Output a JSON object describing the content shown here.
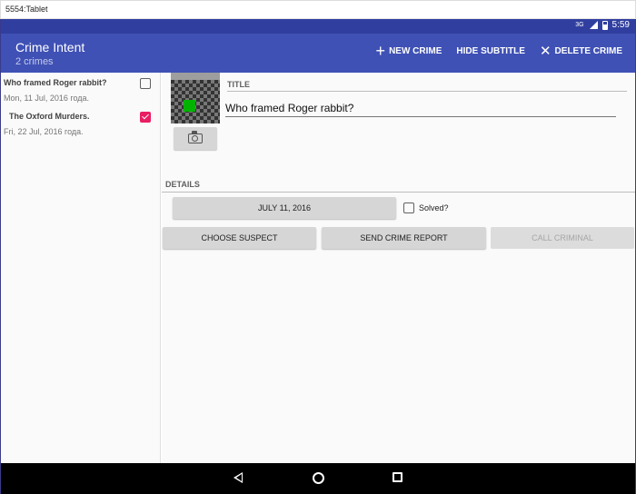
{
  "window": {
    "title": "5554:Tablet"
  },
  "status_bar": {
    "network": "3G",
    "time": "5:59"
  },
  "app_bar": {
    "title": "Crime Intent",
    "subtitle": "2 crimes",
    "actions": {
      "new_crime": "NEW CRIME",
      "hide_subtitle": "HIDE SUBTITLE",
      "delete_crime": "DELETE CRIME"
    }
  },
  "crime_list": [
    {
      "title": "Who framed Roger rabbit?",
      "date": "Mon, 11 Jul, 2016 года.",
      "solved": false
    },
    {
      "title": "The Oxford Murders.",
      "date": "Fri, 22 Jul, 2016 года.",
      "solved": true
    }
  ],
  "detail": {
    "title_label": "TITLE",
    "title_value": "Who framed Roger rabbit?",
    "details_label": "DETAILS",
    "date_button": "JULY 11, 2016",
    "solved_label": "Solved?",
    "solved": false,
    "buttons": {
      "choose_suspect": "CHOOSE SUSPECT",
      "send_report": "SEND CRIME REPORT",
      "call_criminal": "CALL CRIMINAL"
    }
  },
  "colors": {
    "primary": "#3f51b5",
    "primary_dark": "#303f9f",
    "accent": "#e91e63"
  }
}
